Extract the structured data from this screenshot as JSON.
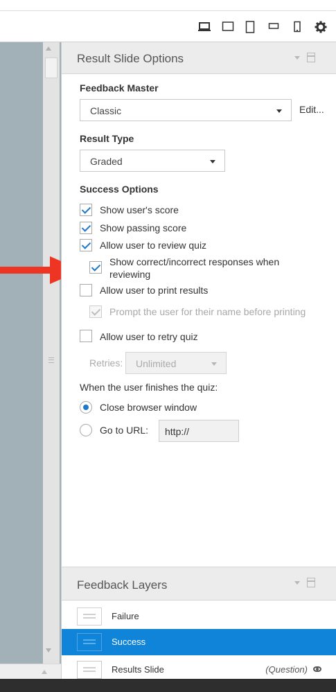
{
  "toolbar": {
    "icons": [
      "laptop-icon",
      "desktop-icon",
      "tablet-portrait-icon",
      "tablet-landscape-icon",
      "phone-icon",
      "gear-icon"
    ]
  },
  "result_slide_options": {
    "title": "Result Slide Options",
    "feedback_master": {
      "label": "Feedback Master",
      "value": "Classic",
      "edit_label": "Edit..."
    },
    "result_type": {
      "label": "Result Type",
      "value": "Graded"
    },
    "success_options": {
      "label": "Success Options",
      "items": [
        {
          "label": "Show user's score",
          "checked": true,
          "enabled": true
        },
        {
          "label": "Show passing score",
          "checked": true,
          "enabled": true
        },
        {
          "label": "Allow user to review quiz",
          "checked": true,
          "enabled": true
        },
        {
          "label_line1": "Show correct/incorrect responses when",
          "label_line2": "reviewing",
          "checked": true,
          "enabled": true
        },
        {
          "label": "Allow user to print results",
          "checked": false,
          "enabled": true
        },
        {
          "label": "Prompt the user for their name before printing",
          "checked": true,
          "enabled": false
        },
        {
          "label": "Allow user to retry quiz",
          "checked": false,
          "enabled": true
        }
      ],
      "retries": {
        "label": "Retries:",
        "value": "Unlimited",
        "enabled": false
      }
    },
    "finish": {
      "label": "When the user finishes the quiz:",
      "options": [
        {
          "label": "Close browser window",
          "selected": true
        },
        {
          "label": "Go to URL:",
          "selected": false
        }
      ],
      "url_value": "http://"
    }
  },
  "feedback_layers": {
    "title": "Feedback Layers",
    "layers": [
      {
        "name": "Failure",
        "selected": false
      },
      {
        "name": "Success",
        "selected": true
      },
      {
        "name": "Results Slide",
        "tag": "(Question)",
        "selected": false
      }
    ]
  },
  "colors": {
    "accent": "#1f78c8",
    "selected_row": "#0f84d8",
    "arrow": "#ee3524"
  }
}
